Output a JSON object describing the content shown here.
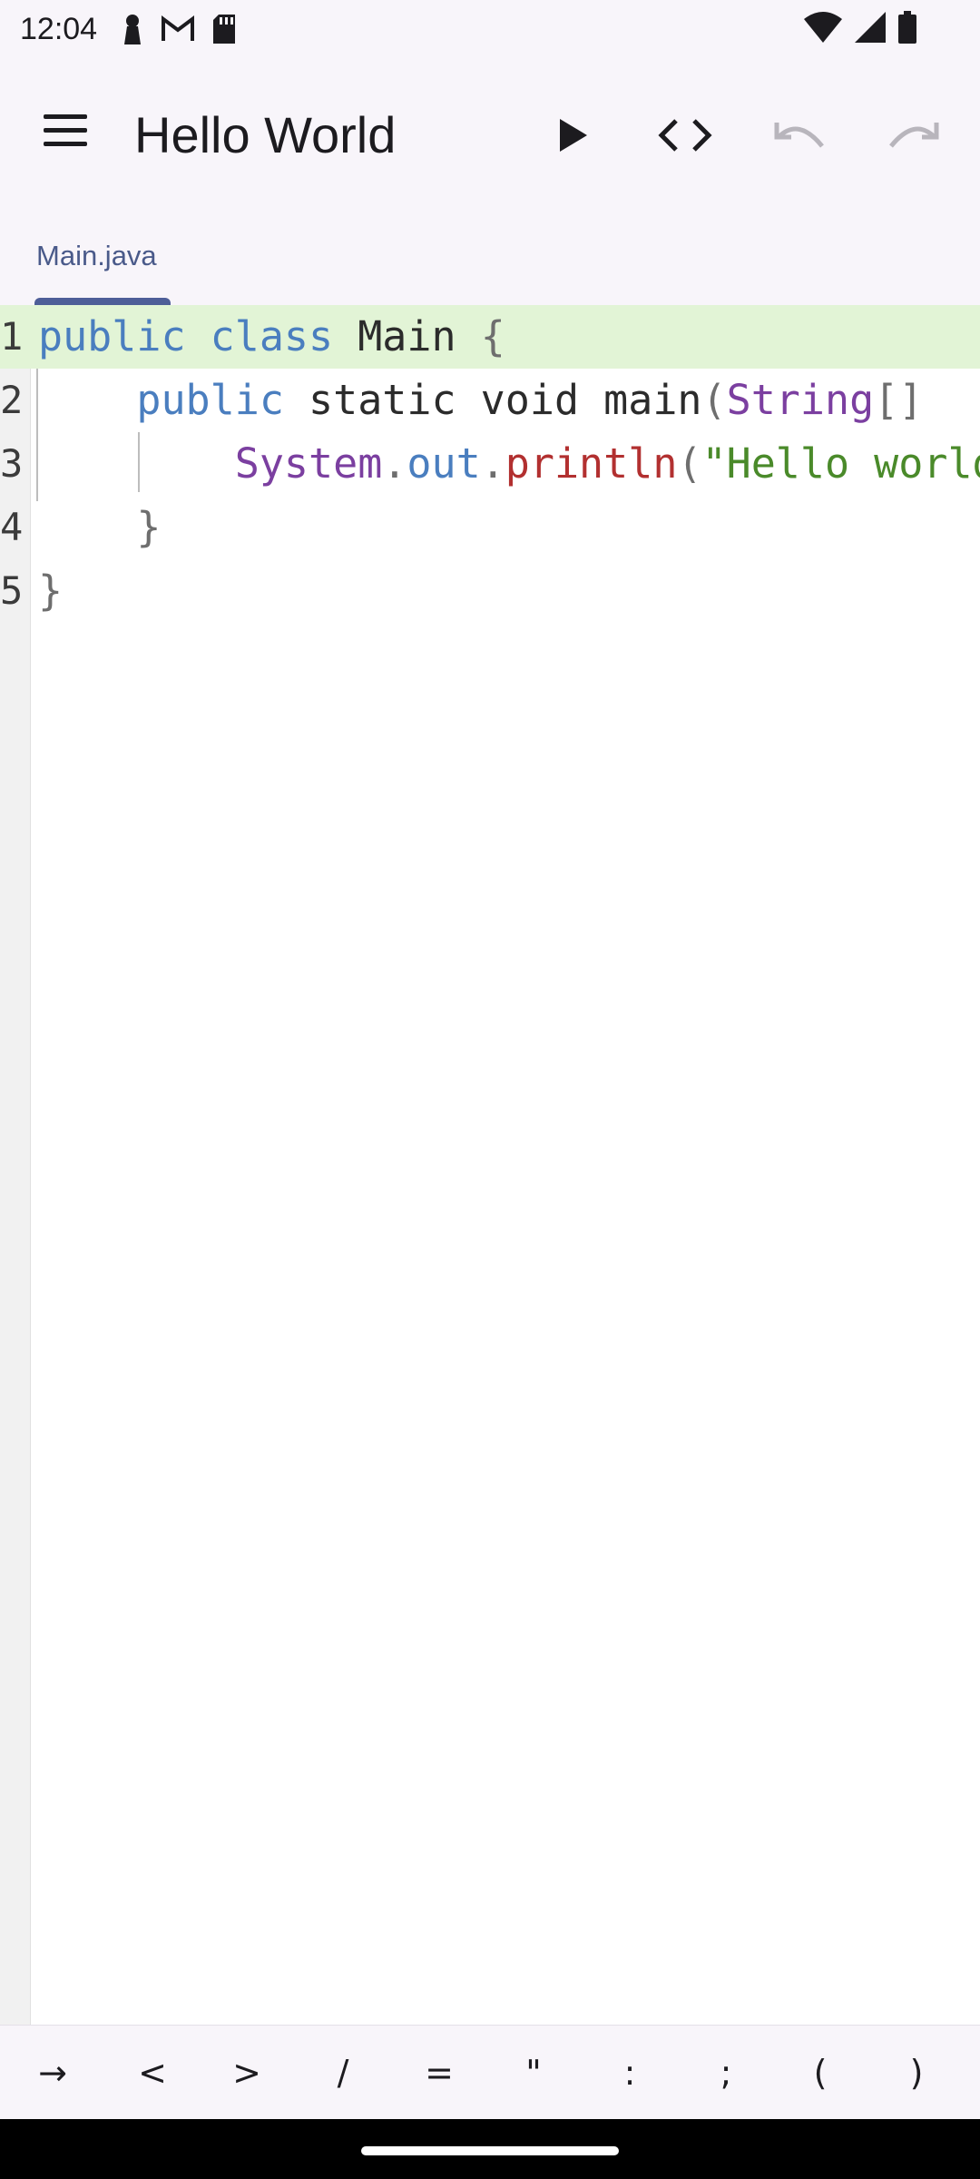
{
  "status_bar": {
    "time": "12:04",
    "left_icons": [
      "person-icon",
      "gmail-icon",
      "sd-card-icon"
    ],
    "right_icons": [
      "wifi-icon",
      "signal-icon",
      "battery-icon"
    ]
  },
  "app_bar": {
    "title": "Hello World",
    "actions": [
      "menu-icon",
      "run-icon",
      "code-icon",
      "undo-icon",
      "redo-icon"
    ]
  },
  "tabs": [
    {
      "label": "Main.java",
      "active": true
    }
  ],
  "editor": {
    "line_numbers": [
      "1",
      "2",
      "3",
      "4",
      "5"
    ],
    "lines": [
      [
        [
          "kw",
          "public "
        ],
        [
          "kw",
          "class "
        ],
        [
          "plain",
          "Main "
        ],
        [
          "brace",
          "{"
        ]
      ],
      [
        [
          "plain",
          "    "
        ],
        [
          "kw",
          "public "
        ],
        [
          "plain",
          "static void main"
        ],
        [
          "brace",
          "("
        ],
        [
          "type",
          "String"
        ],
        [
          "brace",
          "[]"
        ]
      ],
      [
        [
          "plain",
          "        "
        ],
        [
          "type",
          "System"
        ],
        [
          "brace",
          "."
        ],
        [
          "field",
          "out"
        ],
        [
          "brace",
          "."
        ],
        [
          "method",
          "println"
        ],
        [
          "brace",
          "("
        ],
        [
          "str",
          "\"Hello world"
        ]
      ],
      [
        [
          "plain",
          "    "
        ],
        [
          "brace",
          "}"
        ]
      ],
      [
        [
          "brace",
          "}"
        ]
      ]
    ]
  },
  "symbol_bar": {
    "symbols": [
      "→",
      "<",
      ">",
      "/",
      "=",
      "\"",
      ":",
      ";",
      "(",
      ")"
    ]
  }
}
